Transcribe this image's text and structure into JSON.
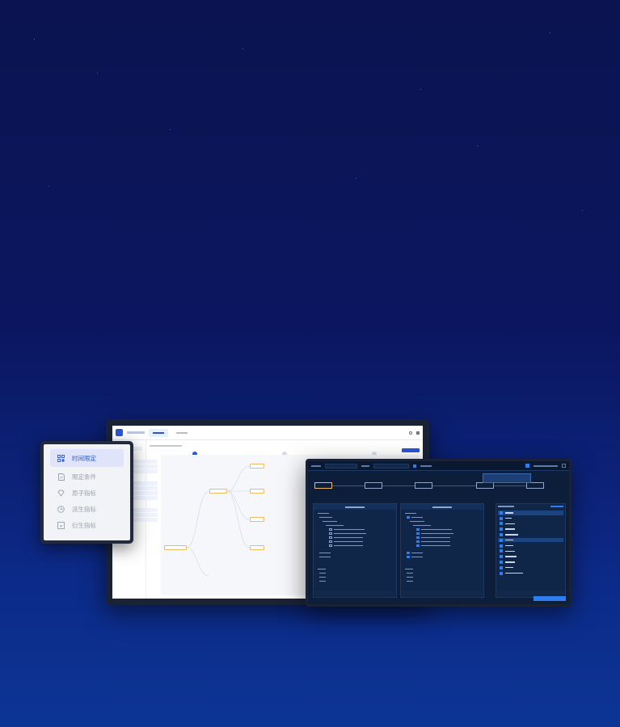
{
  "side_panel": {
    "items": [
      {
        "label": "时间限定",
        "icon": "grid-icon",
        "active": true
      },
      {
        "label": "限定条件",
        "icon": "document-icon",
        "active": false
      },
      {
        "label": "原子指标",
        "icon": "diamond-icon",
        "active": false
      },
      {
        "label": "派生指标",
        "icon": "clock-icon",
        "active": false
      },
      {
        "label": "衍生指标",
        "icon": "box-icon",
        "active": false
      }
    ]
  },
  "colors": {
    "background_top": "#0b1450",
    "background_bottom": "#0c3596",
    "accent": "#2856d8",
    "dark_screen": "#0d1e3a"
  }
}
